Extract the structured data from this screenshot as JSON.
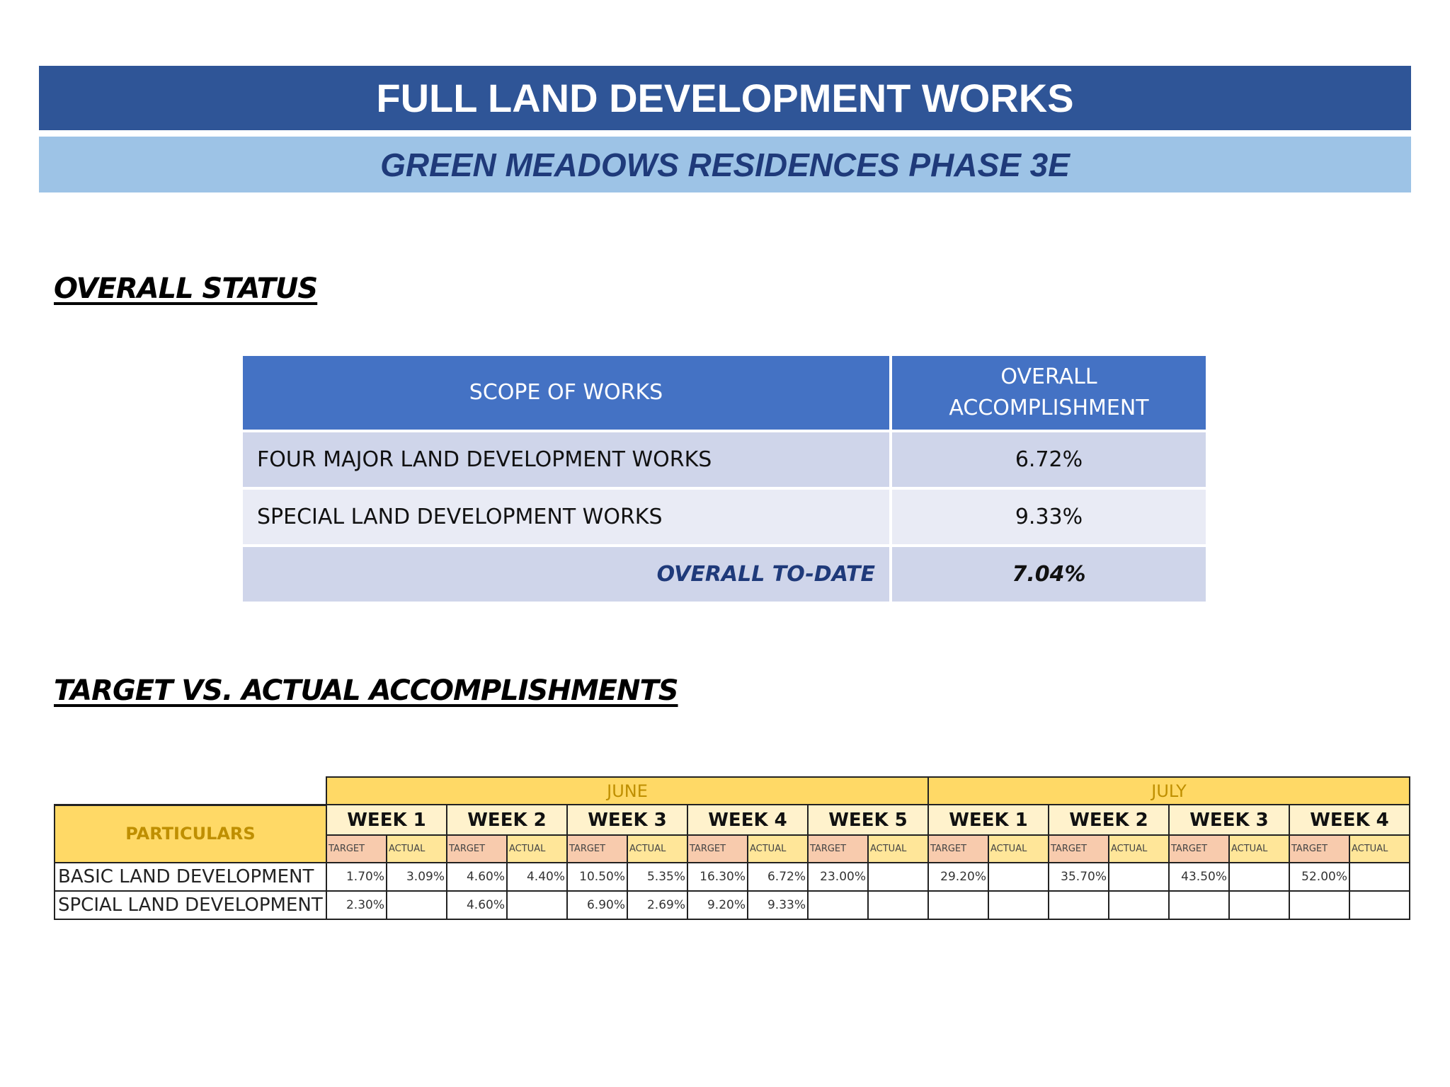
{
  "header": {
    "title": "FULL LAND DEVELOPMENT WORKS",
    "subtitle": "GREEN MEADOWS RESIDENCES PHASE 3E"
  },
  "overall_status": {
    "heading": "OVERALL STATUS",
    "columns": [
      "SCOPE OF WORKS",
      "OVERALL ACCOMPLISHMENT"
    ],
    "rows": [
      {
        "scope": "FOUR MAJOR LAND DEVELOPMENT WORKS",
        "value": "6.72%"
      },
      {
        "scope": "SPECIAL LAND DEVELOPMENT WORKS",
        "value": "9.33%"
      }
    ],
    "total": {
      "label": "OVERALL TO-DATE",
      "value": "7.04%"
    }
  },
  "target_vs_actual": {
    "heading": "TARGET VS. ACTUAL ACCOMPLISHMENTS",
    "particulars_label": "PARTICULARS",
    "target_label": "TARGET",
    "actual_label": "ACTUAL",
    "months": [
      {
        "name": "JUNE",
        "weeks": [
          "WEEK 1",
          "WEEK 2",
          "WEEK 3",
          "WEEK 4",
          "WEEK 5"
        ]
      },
      {
        "name": "JULY",
        "weeks": [
          "WEEK 1",
          "WEEK 2",
          "WEEK 3",
          "WEEK 4"
        ]
      }
    ],
    "rows": [
      {
        "label": "BASIC LAND DEVELOPMENT",
        "values": [
          "1.70%",
          "3.09%",
          "4.60%",
          "4.40%",
          "10.50%",
          "5.35%",
          "16.30%",
          "6.72%",
          "23.00%",
          "",
          "29.20%",
          "",
          "35.70%",
          "",
          "43.50%",
          "",
          "52.00%",
          ""
        ]
      },
      {
        "label": "SPCIAL LAND DEVELOPMENT",
        "values": [
          "2.30%",
          "",
          "4.60%",
          "",
          "6.90%",
          "2.69%",
          "9.20%",
          "9.33%",
          "",
          "",
          "",
          "",
          "",
          "",
          "",
          "",
          "",
          ""
        ]
      }
    ]
  },
  "colors": {
    "title_bar": "#2F5597",
    "subtitle_bar": "#9DC3E6",
    "table_header": "#4472C4",
    "month_header": "#FFD966",
    "target_header": "#F8CBAD"
  }
}
